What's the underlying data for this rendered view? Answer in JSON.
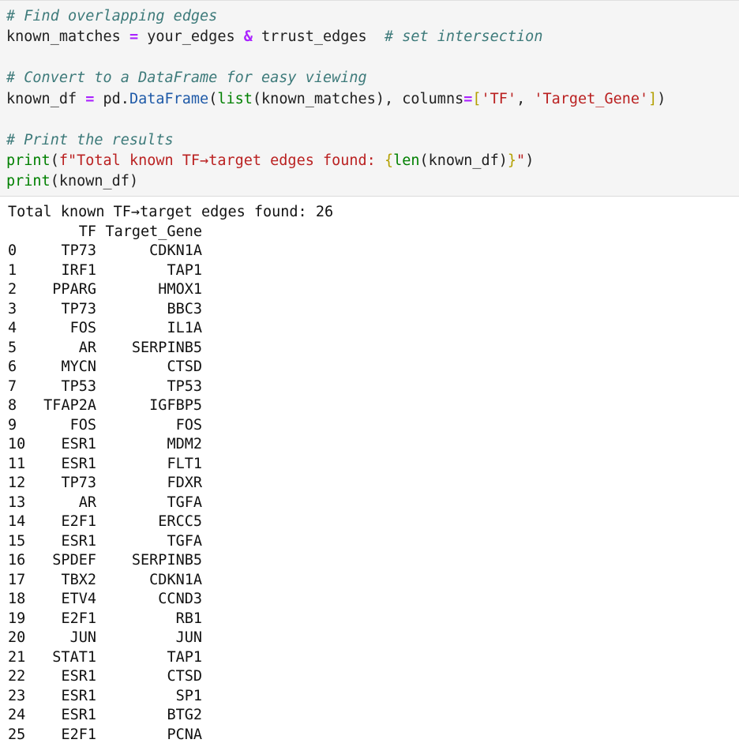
{
  "code": {
    "comment1": "# Find overlapping edges",
    "line2_var": "known_matches",
    "line2_eq": "=",
    "line2_a": "your_edges",
    "line2_amp": "&",
    "line2_b": "trrust_edges",
    "line2_comment": "# set intersection",
    "comment2": "# Convert to a DataFrame for easy viewing",
    "line5_var": "known_df",
    "line5_eq": "=",
    "line5_pd": "pd.",
    "line5_cls": "DataFrame",
    "line5_open": "(",
    "line5_list": "list",
    "line5_args": "(known_matches), columns",
    "line5_eq2": "=",
    "line5_lb": "[",
    "line5_s1": "'TF'",
    "line5_comma": ", ",
    "line5_s2": "'Target_Gene'",
    "line5_rb": "]",
    "line5_close": ")",
    "comment3": "# Print the results",
    "line8_print": "print",
    "line8_open": "(",
    "line8_str_a": "f\"Total known TF→target edges found: ",
    "line8_lbrace": "{",
    "line8_len": "len",
    "line8_arg": "(known_df)",
    "line8_rbrace": "}",
    "line8_str_b": "\"",
    "line8_close": ")",
    "line9_print": "print",
    "line9_arg": "(known_df)"
  },
  "output": {
    "summary": "Total known TF→target edges found: 26",
    "header_tf": "TF",
    "header_target": "Target_Gene",
    "rows": [
      {
        "idx": "0",
        "tf": "TP73",
        "target": "CDKN1A"
      },
      {
        "idx": "1",
        "tf": "IRF1",
        "target": "TAP1"
      },
      {
        "idx": "2",
        "tf": "PPARG",
        "target": "HMOX1"
      },
      {
        "idx": "3",
        "tf": "TP73",
        "target": "BBC3"
      },
      {
        "idx": "4",
        "tf": "FOS",
        "target": "IL1A"
      },
      {
        "idx": "5",
        "tf": "AR",
        "target": "SERPINB5"
      },
      {
        "idx": "6",
        "tf": "MYCN",
        "target": "CTSD"
      },
      {
        "idx": "7",
        "tf": "TP53",
        "target": "TP53"
      },
      {
        "idx": "8",
        "tf": "TFAP2A",
        "target": "IGFBP5"
      },
      {
        "idx": "9",
        "tf": "FOS",
        "target": "FOS"
      },
      {
        "idx": "10",
        "tf": "ESR1",
        "target": "MDM2"
      },
      {
        "idx": "11",
        "tf": "ESR1",
        "target": "FLT1"
      },
      {
        "idx": "12",
        "tf": "TP73",
        "target": "FDXR"
      },
      {
        "idx": "13",
        "tf": "AR",
        "target": "TGFA"
      },
      {
        "idx": "14",
        "tf": "E2F1",
        "target": "ERCC5"
      },
      {
        "idx": "15",
        "tf": "ESR1",
        "target": "TGFA"
      },
      {
        "idx": "16",
        "tf": "SPDEF",
        "target": "SERPINB5"
      },
      {
        "idx": "17",
        "tf": "TBX2",
        "target": "CDKN1A"
      },
      {
        "idx": "18",
        "tf": "ETV4",
        "target": "CCND3"
      },
      {
        "idx": "19",
        "tf": "E2F1",
        "target": "RB1"
      },
      {
        "idx": "20",
        "tf": "JUN",
        "target": "JUN"
      },
      {
        "idx": "21",
        "tf": "STAT1",
        "target": "TAP1"
      },
      {
        "idx": "22",
        "tf": "ESR1",
        "target": "CTSD"
      },
      {
        "idx": "23",
        "tf": "ESR1",
        "target": "SP1"
      },
      {
        "idx": "24",
        "tf": "ESR1",
        "target": "BTG2"
      },
      {
        "idx": "25",
        "tf": "E2F1",
        "target": "PCNA"
      }
    ]
  },
  "colors": {
    "comment": "#3d7a7a",
    "operator": "#aa22ff",
    "builtin": "#008000",
    "string": "#ba2121",
    "attribute": "#1f5aa8",
    "cell_background": "#f5f5f5"
  }
}
